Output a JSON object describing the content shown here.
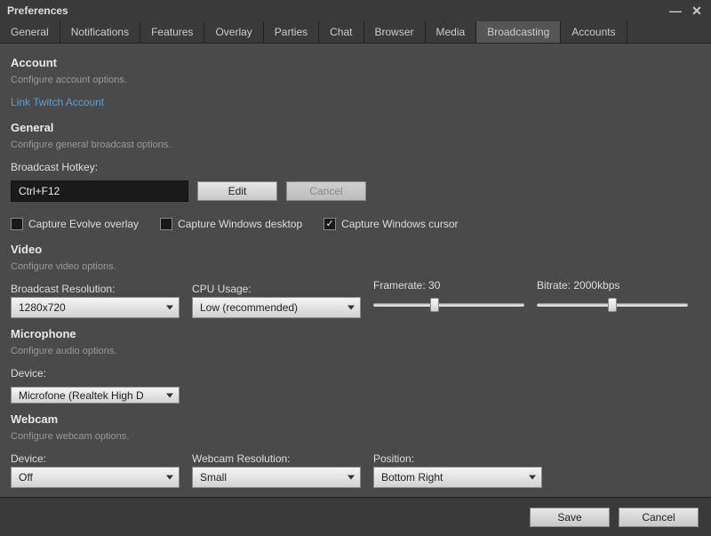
{
  "window": {
    "title": "Preferences"
  },
  "tabs": {
    "items": [
      "General",
      "Notifications",
      "Features",
      "Overlay",
      "Parties",
      "Chat",
      "Browser",
      "Media",
      "Broadcasting",
      "Accounts"
    ],
    "active": "Broadcasting"
  },
  "account": {
    "title": "Account",
    "desc": "Configure account options.",
    "link": "Link Twitch Account"
  },
  "general": {
    "title": "General",
    "desc": "Configure general broadcast options.",
    "hotkey_label": "Broadcast Hotkey:",
    "hotkey_value": "Ctrl+F12",
    "edit_btn": "Edit",
    "cancel_btn": "Cancel",
    "cb_overlay": "Capture Evolve overlay",
    "cb_desktop": "Capture Windows desktop",
    "cb_cursor": "Capture Windows cursor",
    "cb_overlay_checked": false,
    "cb_desktop_checked": false,
    "cb_cursor_checked": true
  },
  "video": {
    "title": "Video",
    "desc": "Configure video options.",
    "resolution_label": "Broadcast Resolution:",
    "resolution_value": "1280x720",
    "cpu_label": "CPU Usage:",
    "cpu_value": "Low (recommended)",
    "framerate_label": "Framerate:",
    "framerate_value": "30",
    "framerate_min": 10,
    "framerate_max": 60,
    "bitrate_label": "Bitrate:",
    "bitrate_value": "2000",
    "bitrate_unit": "kbps",
    "bitrate_min": 500,
    "bitrate_max": 3500
  },
  "microphone": {
    "title": "Microphone",
    "desc": "Configure audio options.",
    "device_label": "Device:",
    "device_value": "Microfone (Realtek High D"
  },
  "webcam": {
    "title": "Webcam",
    "desc": "Configure webcam options.",
    "device_label": "Device:",
    "device_value": "Off",
    "resolution_label": "Webcam Resolution:",
    "resolution_value": "Small",
    "position_label": "Position:",
    "position_value": "Bottom Right"
  },
  "footer": {
    "save": "Save",
    "cancel": "Cancel"
  }
}
